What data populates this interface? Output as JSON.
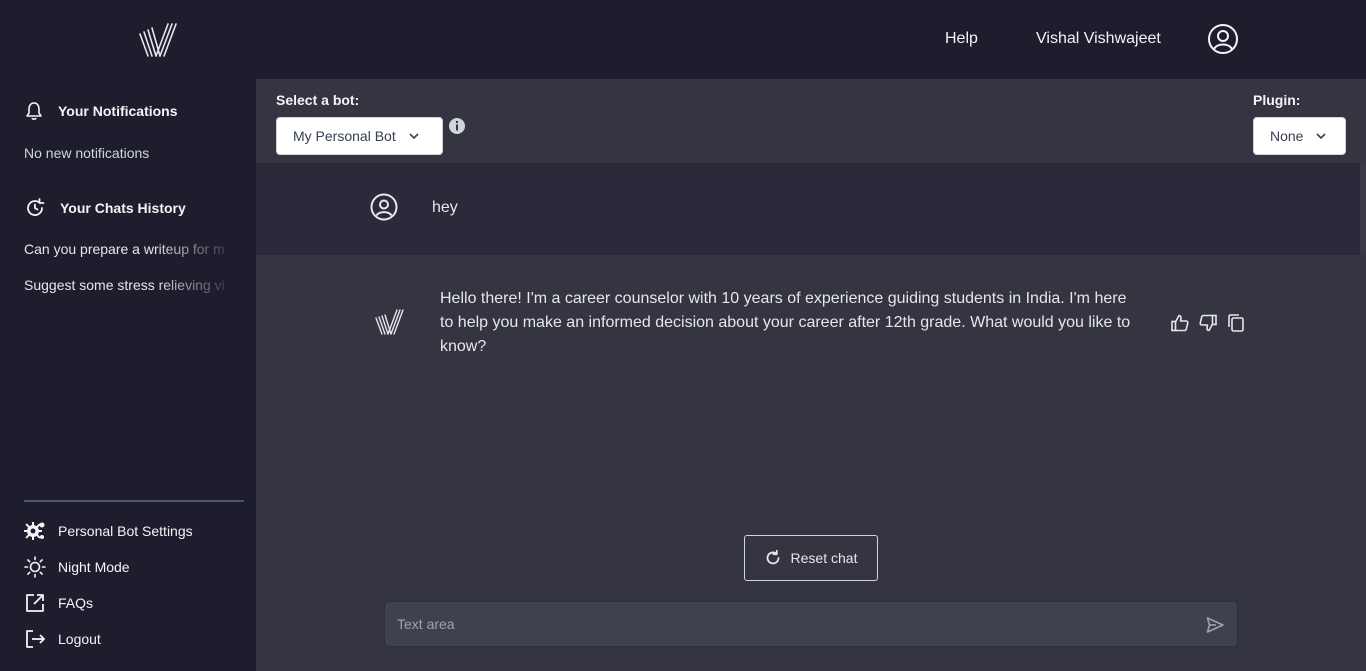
{
  "nav": {
    "help_label": "Help",
    "user_name": "Vishal Vishwajeet"
  },
  "sidebar": {
    "notifications_heading": "Your Notifications",
    "notifications_empty": "No new notifications",
    "history_heading": "Your Chats History",
    "history_items": [
      {
        "label": "Can you prepare a writeup for m"
      },
      {
        "label": "Suggest some stress relieving vi"
      }
    ],
    "links": [
      {
        "label": "Personal Bot Settings",
        "icon": "gear-icon"
      },
      {
        "label": "Night Mode",
        "icon": "sun-icon"
      },
      {
        "label": "FAQs",
        "icon": "external-link-icon"
      },
      {
        "label": "Logout",
        "icon": "logout-icon"
      }
    ]
  },
  "bot_select": {
    "label": "Select a bot:",
    "value": "My Personal Bot"
  },
  "plugin_select": {
    "label": "Plugin:",
    "value": "None"
  },
  "chat": {
    "user_message": "hey",
    "bot_message": "Hello there! I'm a career counselor with 10 years of experience guiding students in India. I'm here to help you make an informed decision about your career after 12th grade. What would you like to know?"
  },
  "reset_label": "Reset chat",
  "input": {
    "placeholder": "Text area",
    "value": ""
  },
  "colors": {
    "sidebar_bg": "#1e1d2e",
    "main_bg": "#343541",
    "user_row_bg": "#2b2a3a"
  }
}
